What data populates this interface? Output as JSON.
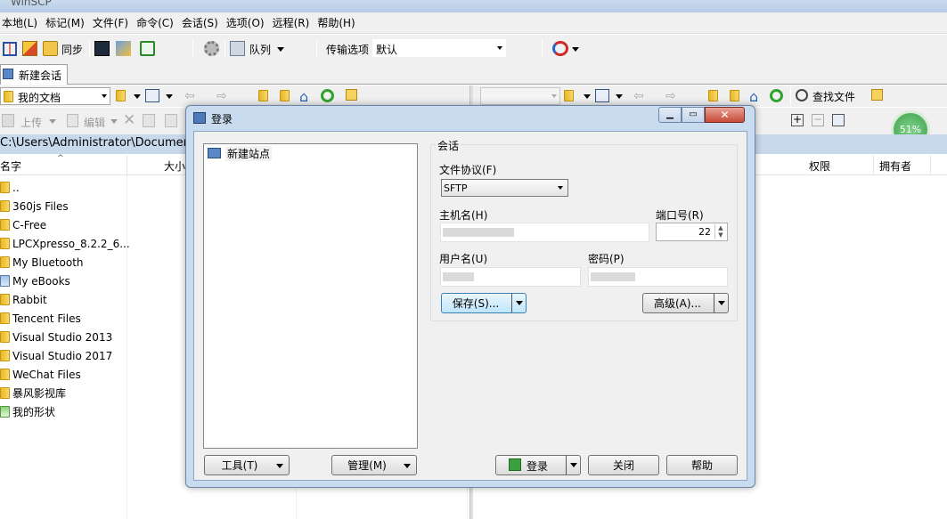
{
  "window": {
    "title": "WinSCP"
  },
  "menu": [
    "本地(L)",
    "标记(M)",
    "文件(F)",
    "命令(C)",
    "会话(S)",
    "选项(O)",
    "远程(R)",
    "帮助(H)"
  ],
  "toolbar": {
    "sync_label": "同步",
    "queue_label": "队列",
    "transfer_label": "传输选项",
    "transfer_value": "默认"
  },
  "session_tab": {
    "label": "新建会话"
  },
  "local": {
    "path_combo": "我的文档",
    "upload_label": "上传",
    "edit_label": "编辑",
    "path": "C:\\Users\\Administrator\\Documents\\",
    "col_name": "名字",
    "col_size": "大小",
    "files": [
      "..",
      "360js Files",
      "C-Free",
      "LPCXpresso_8.2.2_6...",
      "My Bluetooth",
      "My eBooks",
      "Rabbit",
      "Tencent Files",
      "Visual Studio 2013",
      "Visual Studio 2017",
      "WeChat Files",
      "暴风影视库",
      "我的形状"
    ]
  },
  "remote": {
    "find_label": "查找文件",
    "col_perm": "权限",
    "col_owner": "拥有者",
    "progress": "51%"
  },
  "dialog": {
    "title": "登录",
    "site": "新建站点",
    "group": "会话",
    "protocol_label": "文件协议(F)",
    "protocol_value": "SFTP",
    "host_label": "主机名(H)",
    "port_label": "端口号(R)",
    "port_value": "22",
    "user_label": "用户名(U)",
    "password_label": "密码(P)",
    "save_label": "保存(S)...",
    "advanced_label": "高级(A)...",
    "tools_label": "工具(T)",
    "manage_label": "管理(M)",
    "login_label": "登录",
    "close_label": "关闭",
    "help_label": "帮助"
  }
}
